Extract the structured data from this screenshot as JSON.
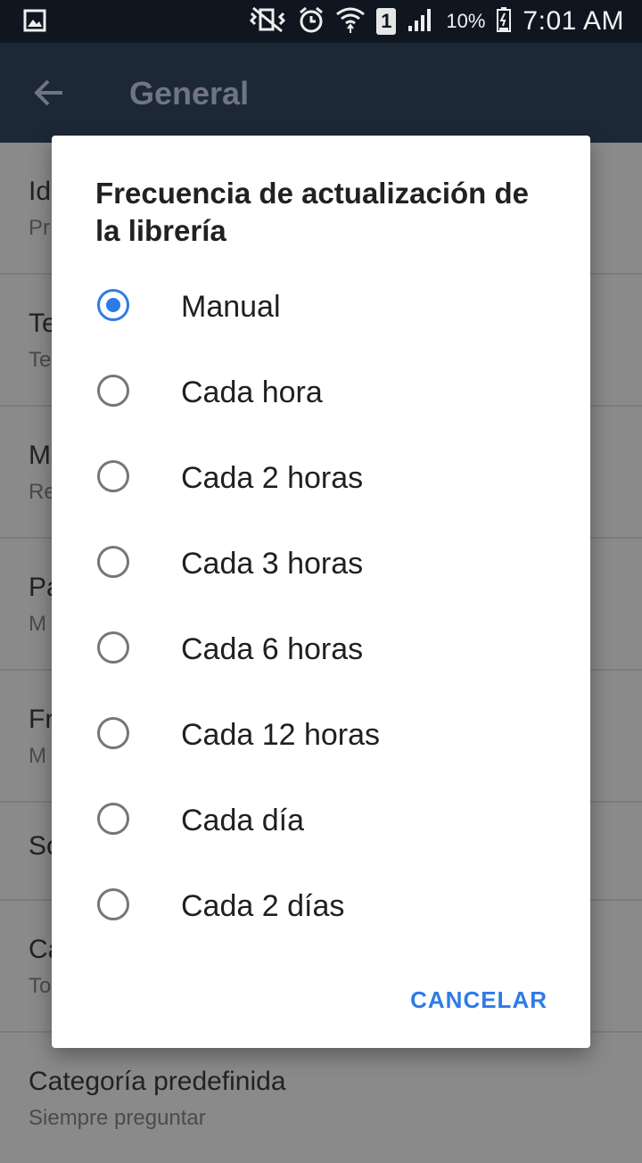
{
  "status_bar": {
    "icons": [
      "image-notification-icon",
      "vibrate-icon",
      "alarm-icon",
      "wifi-icon",
      "sim-icon",
      "signal-icon",
      "battery-icon"
    ],
    "sim_number": "1",
    "battery": "10%",
    "time": "7:01 AM"
  },
  "app_bar": {
    "title": "General"
  },
  "settings_list": {
    "items": [
      {
        "title": "Id",
        "subtitle": "Pr"
      },
      {
        "title": "Te",
        "subtitle": "Te"
      },
      {
        "title": "M",
        "subtitle": "Re"
      },
      {
        "title": "Pa",
        "subtitle": "M"
      },
      {
        "title": "Fr",
        "subtitle": "M"
      },
      {
        "title": "So",
        "subtitle": ""
      },
      {
        "title": "Ca",
        "subtitle": "To"
      },
      {
        "title": "Categoría predefinida",
        "subtitle": "Siempre preguntar"
      }
    ]
  },
  "dialog": {
    "title": "Frecuencia de actualización de la librería",
    "selected": "Manual",
    "options": [
      {
        "label": "Manual",
        "checked": true
      },
      {
        "label": "Cada hora",
        "checked": false
      },
      {
        "label": "Cada 2 horas",
        "checked": false
      },
      {
        "label": "Cada 3 horas",
        "checked": false
      },
      {
        "label": "Cada 6 horas",
        "checked": false
      },
      {
        "label": "Cada 12 horas",
        "checked": false
      },
      {
        "label": "Cada día",
        "checked": false
      },
      {
        "label": "Cada 2 días",
        "checked": false
      }
    ],
    "cancel_label": "CANCELAR",
    "accent_color": "#2f7be6"
  }
}
